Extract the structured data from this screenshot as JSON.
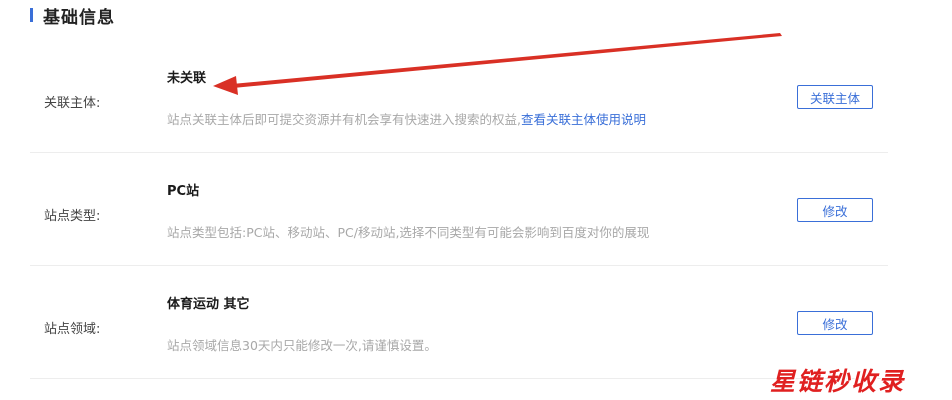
{
  "section": {
    "title": "基础信息",
    "accent_color": "#3a6fd8"
  },
  "rows": [
    {
      "label": "关联主体:",
      "value": "未关联",
      "desc": "站点关联主体后即可提交资源并有机会享有快速进入搜索的权益,",
      "link": "查看关联主体使用说明",
      "button": "关联主体"
    },
    {
      "label": "站点类型:",
      "value": "PC站",
      "desc": "站点类型包括:PC站、移动站、PC/移动站,选择不同类型有可能会影响到百度对你的展现",
      "link": "",
      "button": "修改"
    },
    {
      "label": "站点领域:",
      "value": "体育运动 其它",
      "desc": "站点领域信息30天内只能修改一次,请谨慎设置。",
      "link": "",
      "button": "修改"
    }
  ],
  "annotation": {
    "arrow_color": "#d93025",
    "arrow_target": "rows.0.value"
  },
  "watermark": {
    "text": "星链秒收录",
    "color": "#e02020"
  }
}
